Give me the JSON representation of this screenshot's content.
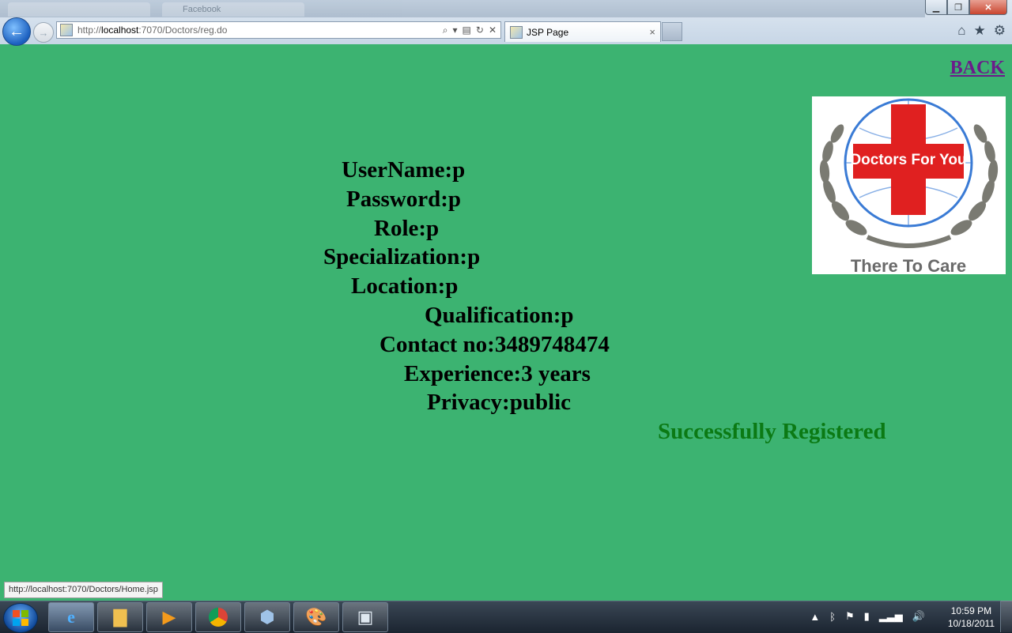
{
  "browser": {
    "address_prefix": "http://",
    "address_host": "localhost",
    "address_rest": ":7070/Doctors/reg.do",
    "tab_title": "JSP Page",
    "tab_close": "×",
    "ghost_tab_1": "",
    "ghost_tab_2": "Facebook"
  },
  "page": {
    "back_link": "BACK",
    "logo": {
      "title": "Doctors For You",
      "tagline": "There To Care"
    },
    "fields": [
      {
        "label": "UserName",
        "value": "p"
      },
      {
        "label": "Password",
        "value": "p"
      },
      {
        "label": "Role",
        "value": "p"
      },
      {
        "label": "Specialization",
        "value": "p"
      },
      {
        "label": "Location",
        "value": "p"
      },
      {
        "label": "Qualification",
        "value": "p"
      },
      {
        "label": "Contact no",
        "value": "3489748474"
      },
      {
        "label": "Experience",
        "value": "3 years"
      },
      {
        "label": "Privacy",
        "value": "public"
      }
    ],
    "success_message": "Successfully Registered"
  },
  "status_bar": {
    "url": "http://localhost:7070/Doctors/Home.jsp"
  },
  "taskbar": {
    "time": "10:59 PM",
    "date": "10/18/2011"
  },
  "colors": {
    "page_background": "#3cb371",
    "success_text": "#0b7a14",
    "back_link": "#6b1b8a",
    "logo_red": "#e02020"
  }
}
